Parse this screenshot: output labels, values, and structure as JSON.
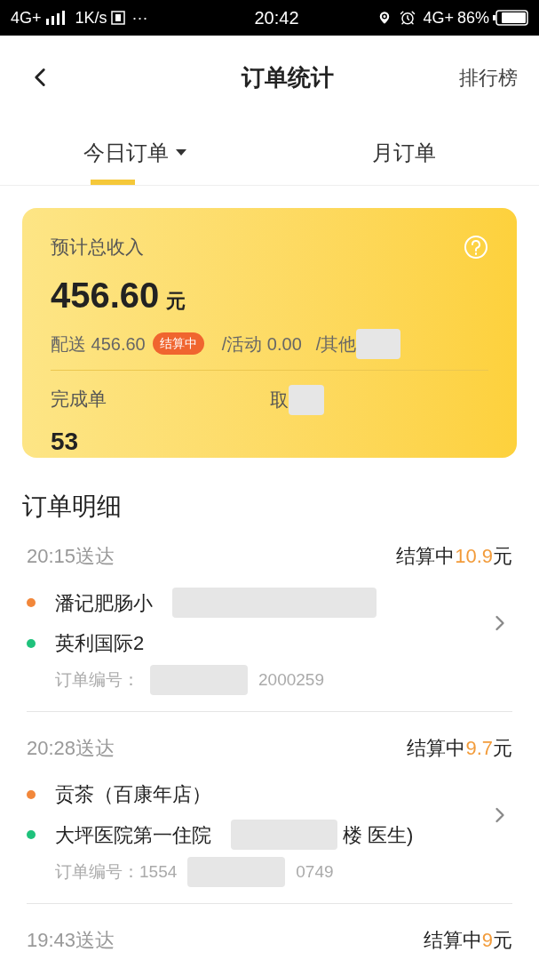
{
  "status_bar": {
    "network_left": "4G+",
    "speed": "1K/s",
    "more": "···",
    "time": "20:42",
    "network_right": "4G+",
    "battery": "86%"
  },
  "header": {
    "title": "订单统计",
    "action": "排行榜"
  },
  "tabs": [
    {
      "label": "今日订单",
      "selected": true,
      "dropdown": true
    },
    {
      "label": "月订单",
      "selected": false,
      "dropdown": false
    }
  ],
  "income": {
    "label": "预计总收入",
    "amount": "456.60",
    "unit": "元",
    "delivery": "配送 456.60",
    "badge": "结算中",
    "activity": "/活动 0.00",
    "other": "/其他",
    "stats": [
      {
        "label": "完成单",
        "value": "53"
      },
      {
        "label": "取",
        "redacted": true
      }
    ]
  },
  "section_title": "订单明细",
  "orders": [
    {
      "time": "20:15送达",
      "status": "结算中",
      "amount": "10.9",
      "unit": "元",
      "stops": [
        {
          "text": "潘记肥肠小",
          "color": "#f2873a"
        },
        {
          "text": "英利国际2",
          "color": "#1fc27c"
        }
      ],
      "order_label": "订单编号：",
      "order_tail": "2000259"
    },
    {
      "time": "20:28送达",
      "status": "结算中",
      "amount": "9.7",
      "unit": "元",
      "stops": [
        {
          "text": "贡茶（百康年店）",
          "color": "#f2873a"
        },
        {
          "text": "大坪医院第一住院",
          "tail": "楼 医生)",
          "color": "#1fc27c"
        }
      ],
      "order_label": "订单编号：1554",
      "order_tail": "0749"
    },
    {
      "time": "19:43送达",
      "status": "结算中",
      "amount": "9",
      "unit": "元"
    }
  ]
}
